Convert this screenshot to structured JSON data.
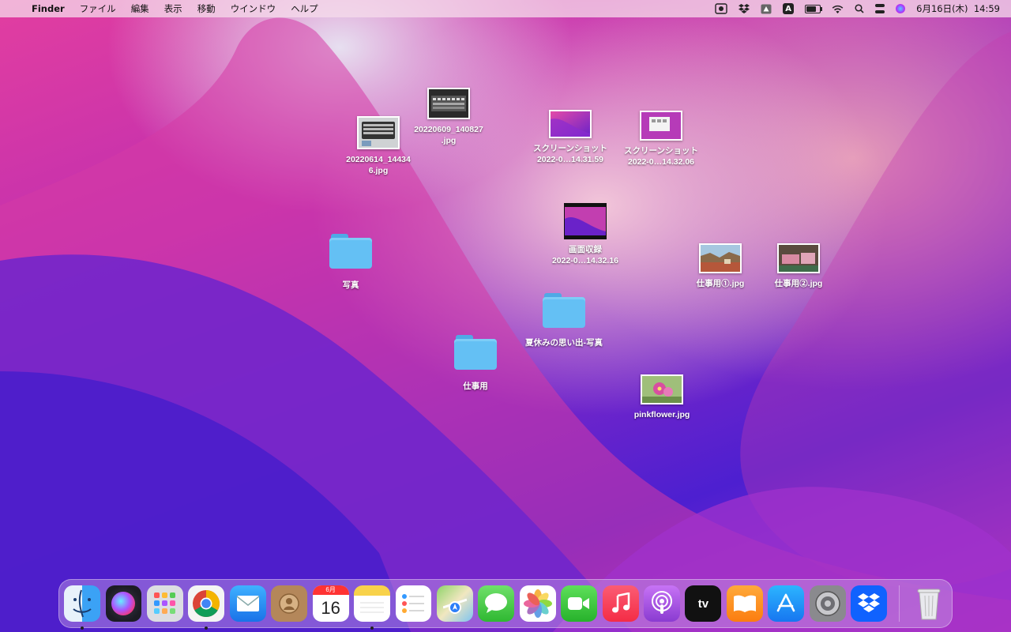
{
  "menubar": {
    "app_name": "Finder",
    "menus": [
      "ファイル",
      "編集",
      "表示",
      "移動",
      "ウインドウ",
      "ヘルプ"
    ],
    "status_icons": [
      "screenshot-icon",
      "dropbox-icon",
      "drive-icon",
      "input-source-icon",
      "battery-icon",
      "wifi-icon",
      "spotlight-icon",
      "control-center-icon",
      "siri-icon"
    ],
    "input_source_label": "A",
    "clock": "6月16日(木)  14:59"
  },
  "desktop_icons": {
    "img1": "20220609_140827\n.jpg",
    "img2": "20220614_14434\n6.jpg",
    "ss1": "スクリーンショット\n2022-0…14.31.59",
    "ss2": "スクリーンショット\n2022-0…14.32.06",
    "rec": "画面収録\n2022-0…14.32.16",
    "folder_photos": "写真",
    "work1": "仕事用①.jpg",
    "work2": "仕事用②.jpg",
    "folder_summer": "夏休みの思い出-写真",
    "folder_work": "仕事用",
    "pinkflower": "pinkflower.jpg"
  },
  "dock": {
    "items": [
      "finder",
      "siri",
      "launchpad",
      "chrome",
      "mail",
      "contacts",
      "calendar",
      "notes",
      "reminders",
      "maps",
      "messages",
      "photos",
      "facetime",
      "music",
      "podcasts",
      "apple-tv",
      "books",
      "app-store",
      "system-preferences",
      "dropbox",
      "trash"
    ],
    "calendar_month": "6月",
    "calendar_day": "16",
    "tv_label": "tv",
    "running": [
      "finder",
      "chrome",
      "notes"
    ]
  },
  "colors": {
    "folder": "#64c0f4",
    "menubar": "#f5dceb"
  }
}
